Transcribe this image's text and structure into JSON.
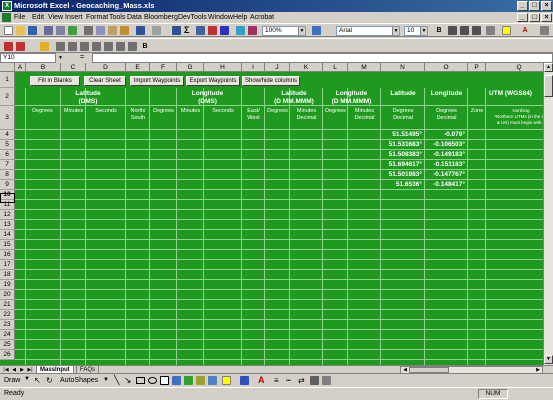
{
  "app": {
    "title": "Microsoft Excel - Geocaching_Mass.xls"
  },
  "menu": [
    "File",
    "Edit",
    "View",
    "Insert",
    "Format",
    "Tools",
    "Data",
    "Bloomberg",
    "DevTools",
    "Window",
    "Help",
    "Acrobat"
  ],
  "toolbar": {
    "zoom": "100%",
    "font": "Arial",
    "font_size": "10"
  },
  "namebox": "Y10",
  "fx": "=",
  "columns": [
    "A",
    "B",
    "C",
    "D",
    "E",
    "F",
    "G",
    "H",
    "I",
    "J",
    "K",
    "L",
    "M",
    "N",
    "O",
    "P",
    "Q"
  ],
  "buttons": [
    "Fill in Blanks",
    "Clear Sheet",
    "Import Waypoints",
    "Export Waypoints",
    "Show/hide columns"
  ],
  "groups": {
    "lat_dms": "Latitude\n(DMS)",
    "lon_dms": "Longitude\n(DMS)",
    "lat_mm": "Latitude\n(D MM.MMM)",
    "lon_mm": "Longitude\n(D MM.MMM)",
    "lat": "Latitude",
    "lon": "Longitude",
    "utm": "UTM (WGS84)"
  },
  "subheaders": {
    "b": "Degrees",
    "c": "Minutes",
    "d": "Seconds",
    "e": "North/\nSouth",
    "f": "Degrees",
    "g": "Minutes",
    "h": "Seconds",
    "i": "East/\nWest",
    "j": "Degrees",
    "k": "Minutes\nDecimal",
    "l": "Degrees",
    "m": "Minutes\nDecimal",
    "n": "Degrees\nDecimal",
    "o": "Degrees\nDecimal",
    "p": "Zone",
    "q": "Northing\n*Northern UTMs (in the US\n& UK) must begin with 0"
  },
  "row_numbers": [
    "1",
    "2",
    "3",
    "4",
    "5",
    "6",
    "7",
    "8",
    "9",
    "10",
    "11",
    "12",
    "13",
    "14",
    "15",
    "16",
    "17",
    "18",
    "19",
    "20",
    "21",
    "22",
    "23",
    "24",
    "25",
    "26"
  ],
  "data_rows": [
    {
      "lat": "51.51495°",
      "lon": "-0.079°"
    },
    {
      "lat": "51.531683°",
      "lon": "-0.106503°"
    },
    {
      "lat": "51.508383°",
      "lon": "-0.149183°"
    },
    {
      "lat": "51.694617°",
      "lon": "-0.151183°"
    },
    {
      "lat": "51.501983°",
      "lon": "-0.147767°"
    },
    {
      "lat": "51.6536°",
      "lon": "-0.148417°"
    }
  ],
  "tabs": [
    "MassInput",
    "FAQs"
  ],
  "drawbar": {
    "draw": "Draw",
    "autoshapes": "AutoShapes"
  },
  "status": {
    "left": "Ready",
    "num": "NUM"
  },
  "colors": {
    "sheet": "#1f9a1f",
    "title_start": "#0a246a",
    "title_end": "#3a6ea5"
  }
}
